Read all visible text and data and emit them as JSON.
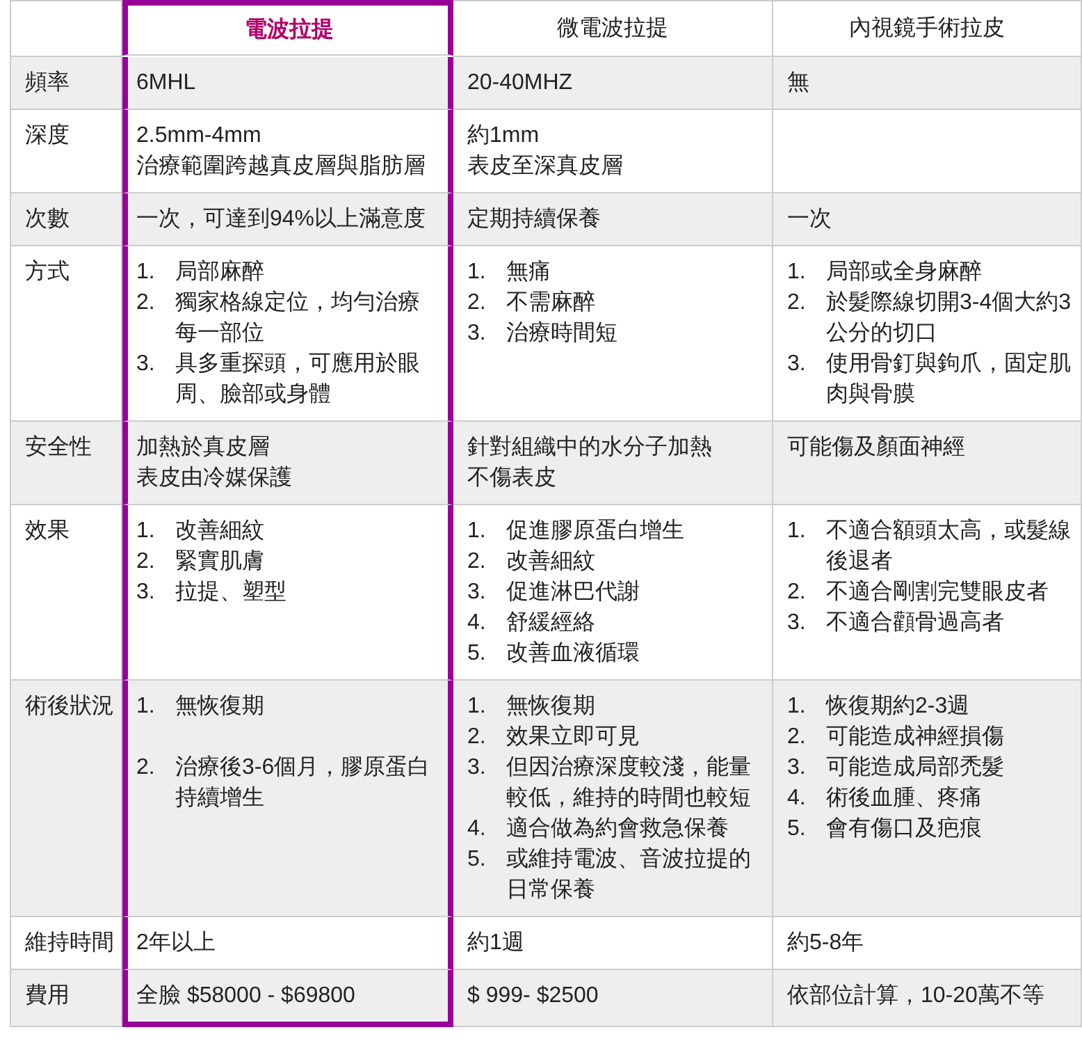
{
  "columns": [
    {
      "label": "電波拉提",
      "selected": true
    },
    {
      "label": "微電波拉提",
      "selected": false
    },
    {
      "label": "內視鏡手術拉皮",
      "selected": false
    }
  ],
  "rows": [
    {
      "label": "頻率",
      "cells": [
        {
          "kind": "text",
          "lines": [
            "6MHL"
          ]
        },
        {
          "kind": "text",
          "lines": [
            "20-40MHZ"
          ]
        },
        {
          "kind": "text",
          "lines": [
            "無"
          ]
        }
      ]
    },
    {
      "label": "深度",
      "cells": [
        {
          "kind": "text",
          "lines": [
            "2.5mm-4mm",
            "治療範圍跨越真皮層與脂肪層"
          ]
        },
        {
          "kind": "text",
          "lines": [
            "約1mm",
            "表皮至深真皮層"
          ]
        },
        {
          "kind": "empty"
        }
      ]
    },
    {
      "label": "次數",
      "cells": [
        {
          "kind": "text",
          "lines": [
            "一次，可達到94%以上滿意度"
          ]
        },
        {
          "kind": "text",
          "lines": [
            "定期持續保養"
          ]
        },
        {
          "kind": "text",
          "lines": [
            "一次"
          ]
        }
      ]
    },
    {
      "label": "方式",
      "cells": [
        {
          "kind": "list",
          "items": [
            {
              "num": "1.",
              "text": "局部麻醉"
            },
            {
              "num": "2.",
              "text": "獨家格線定位，均勻治療每一部位"
            },
            {
              "num": "3.",
              "text": "具多重探頭，可應用於眼周、臉部或身體"
            }
          ]
        },
        {
          "kind": "list",
          "items": [
            {
              "num": "1.",
              "text": "無痛"
            },
            {
              "num": "2.",
              "text": "不需麻醉"
            },
            {
              "num": "3.",
              "text": "治療時間短"
            }
          ]
        },
        {
          "kind": "list",
          "items": [
            {
              "num": "1.",
              "text": "局部或全身麻醉"
            },
            {
              "num": "2.",
              "text": "於髮際線切開3-4個大約3公分的切口"
            },
            {
              "num": "3.",
              "text": "使用骨釘與鉤爪，固定肌肉與骨膜"
            }
          ]
        }
      ]
    },
    {
      "label": "安全性",
      "cells": [
        {
          "kind": "text",
          "lines": [
            "加熱於真皮層",
            "表皮由冷媒保護"
          ]
        },
        {
          "kind": "text",
          "lines": [
            "針對組織中的水分子加熱",
            "不傷表皮"
          ]
        },
        {
          "kind": "text",
          "lines": [
            "可能傷及顏面神經"
          ]
        }
      ]
    },
    {
      "label": "效果",
      "cells": [
        {
          "kind": "list",
          "items": [
            {
              "num": "1.",
              "text": "改善細紋"
            },
            {
              "num": "2.",
              "text": "緊實肌膚"
            },
            {
              "num": "3.",
              "text": "拉提、塑型"
            }
          ]
        },
        {
          "kind": "list",
          "items": [
            {
              "num": "1.",
              "text": "促進膠原蛋白增生"
            },
            {
              "num": "2.",
              "text": "改善細紋"
            },
            {
              "num": "3.",
              "text": "促進淋巴代謝"
            },
            {
              "num": "4.",
              "text": "舒緩經絡"
            },
            {
              "num": "5.",
              "text": "改善血液循環"
            }
          ]
        },
        {
          "kind": "list",
          "items": [
            {
              "num": "1.",
              "text": "不適合額頭太高，或髮線後退者"
            },
            {
              "num": "2.",
              "text": "不適合剛割完雙眼皮者"
            },
            {
              "num": "3.",
              "text": "不適合顴骨過高者"
            }
          ]
        }
      ]
    },
    {
      "label": "術後狀況",
      "cells": [
        {
          "kind": "list",
          "loose": true,
          "items": [
            {
              "num": "1.",
              "text": "無恢復期"
            },
            {
              "num": "2.",
              "text": "治療後3-6個月，膠原蛋白持續增生"
            }
          ]
        },
        {
          "kind": "list",
          "items": [
            {
              "num": "1.",
              "text": "無恢復期"
            },
            {
              "num": "2.",
              "text": "效果立即可見"
            },
            {
              "num": "3.",
              "text": "但因治療深度較淺，能量較低，維持的時間也較短"
            },
            {
              "num": "4.",
              "text": "適合做為約會救急保養"
            },
            {
              "num": "5.",
              "text": "或維持電波、音波拉提的日常保養"
            }
          ]
        },
        {
          "kind": "list",
          "items": [
            {
              "num": "1.",
              "text": "恢復期約2-3週"
            },
            {
              "num": "2.",
              "text": "可能造成神經損傷"
            },
            {
              "num": "3.",
              "text": "可能造成局部禿髮"
            },
            {
              "num": "4.",
              "text": "術後血腫、疼痛"
            },
            {
              "num": "5.",
              "text": "會有傷口及疤痕"
            }
          ]
        }
      ]
    },
    {
      "label": "維持時間",
      "cells": [
        {
          "kind": "text",
          "lines": [
            "2年以上"
          ]
        },
        {
          "kind": "text",
          "lines": [
            "約1週"
          ]
        },
        {
          "kind": "text",
          "lines": [
            "約5-8年"
          ]
        }
      ]
    },
    {
      "label": "費用",
      "cells": [
        {
          "kind": "text",
          "lines": [
            "全臉 $58000 - $69800"
          ]
        },
        {
          "kind": "text",
          "lines": [
            "$ 999- $2500"
          ]
        },
        {
          "kind": "text",
          "lines": [
            "依部位計算，10-20萬不等"
          ]
        }
      ]
    }
  ]
}
